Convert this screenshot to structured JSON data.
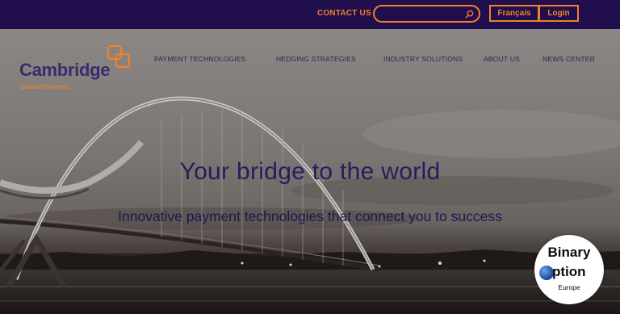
{
  "topbar": {
    "contact_label": "CONTACT US",
    "search_placeholder": "",
    "lang_label": "Français",
    "login_label": "Login"
  },
  "brand": {
    "name": "Cambridge",
    "tagline": "Global Payments"
  },
  "nav": {
    "items": [
      "PAYMENT TECHNOLOGIES",
      "HEDGING STRATEGIES",
      "INDUSTRY SOLUTIONS",
      "ABOUT US",
      "NEWS CENTER"
    ]
  },
  "hero": {
    "headline": "Your bridge to the world",
    "subline": "Innovative payment technologies that connect you to success"
  },
  "watermark": {
    "line1": "Binary",
    "line2": "ption",
    "line3": "Europe"
  },
  "colors": {
    "topbar_bg": "#210e4d",
    "accent": "#f0822a",
    "brand_purple": "#3b2a6e"
  }
}
